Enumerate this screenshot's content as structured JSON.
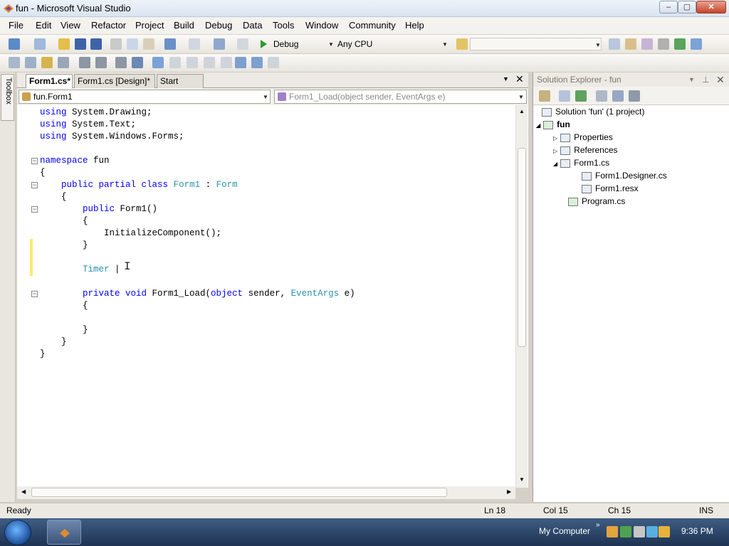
{
  "window": {
    "title": "fun - Microsoft Visual Studio",
    "buttons": {
      "minimize": "–",
      "maximize": "▢",
      "close": "✕"
    }
  },
  "menu": [
    "File",
    "Edit",
    "View",
    "Refactor",
    "Project",
    "Build",
    "Debug",
    "Data",
    "Tools",
    "Window",
    "Community",
    "Help"
  ],
  "toolbar": {
    "config": "Debug",
    "platform": "Any CPU"
  },
  "toolbox": {
    "label": "Toolbox"
  },
  "doc_tabs": [
    "Form1.cs*",
    "Form1.cs [Design]*",
    "Start Page"
  ],
  "navbar": {
    "type_combo": "fun.Form1",
    "member_combo": "Form1_Load(object sender, EventArgs e)"
  },
  "code": [
    "using System.Drawing;",
    "using System.Text;",
    "using System.Windows.Forms;",
    "",
    "namespace fun",
    "{",
    "    public partial class Form1 : Form",
    "    {",
    "        public Form1()",
    "        {",
    "            InitializeComponent();",
    "        }",
    "",
    "        Timer |",
    "",
    "        private void Form1_Load(object sender, EventArgs e)",
    "        {",
    "",
    "        }",
    "    }",
    "}"
  ],
  "solution_explorer": {
    "title": "Solution Explorer - fun",
    "items": [
      {
        "label": "Solution 'fun' (1 project)"
      },
      {
        "label": "fun"
      },
      {
        "label": "Properties"
      },
      {
        "label": "References"
      },
      {
        "label": "Form1.cs"
      },
      {
        "label": "Form1.Designer.cs"
      },
      {
        "label": "Form1.resx"
      },
      {
        "label": "Program.cs"
      }
    ]
  },
  "status": {
    "state": "Ready",
    "line": "Ln 18",
    "col": "Col 15",
    "ch": "Ch 15",
    "mode": "INS"
  },
  "taskbar": {
    "tray_label": "My Computer",
    "clock": "9:36 PM"
  },
  "colors": {
    "keyword": "#0000ff",
    "type": "#2b91af",
    "changed_line_marker": "#ffea6e"
  }
}
